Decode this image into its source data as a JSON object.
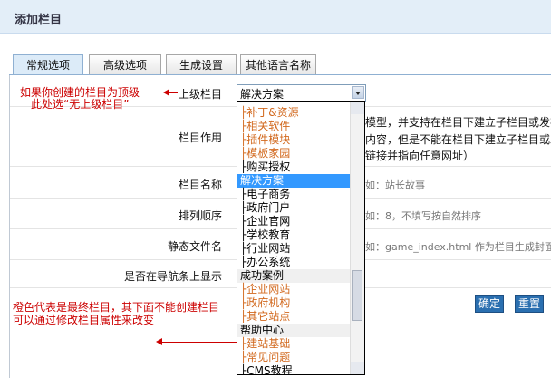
{
  "header": {
    "title": "添加栏目"
  },
  "tabs": [
    {
      "label": "常规选项",
      "active": true
    },
    {
      "label": "高级选项",
      "active": false
    },
    {
      "label": "生成设置",
      "active": false
    },
    {
      "label": "其他语言名称",
      "active": false
    }
  ],
  "form": {
    "parent": {
      "label": "上级栏目",
      "value": "解决方案"
    },
    "role": {
      "label": "栏目作用",
      "text1": "模型，并支持在栏目下建立子栏目或发布",
      "text2": "内容，但是不能在栏目下建立子栏目或发布",
      "text3": "链接并指向任意网址）"
    },
    "name": {
      "label": "栏目名称",
      "hint": "如：站长故事"
    },
    "order": {
      "label": "排列顺序",
      "hint": "如：8，不填写按自然排序"
    },
    "static": {
      "label": "静态文件名",
      "hint": "如：game_index.html 作为栏目生成封面"
    },
    "nav": {
      "label": "是否在导航条上显示"
    }
  },
  "notes": {
    "top_line1": "如果你创建的栏目为顶级",
    "top_line2": "此处选“无上级栏目”",
    "bottom_line1": "橙色代表是最终栏目，其下面不能创建栏目",
    "bottom_line2": "可以通过修改栏目属性来改变"
  },
  "dropdown": {
    "options": [
      {
        "label": "├补丁&资源",
        "kind": "leaf"
      },
      {
        "label": "├相关软件",
        "kind": "leaf"
      },
      {
        "label": "├插件模块",
        "kind": "leaf"
      },
      {
        "label": "├模板家园",
        "kind": "leaf"
      },
      {
        "label": "├购买授权",
        "kind": "normal"
      },
      {
        "label": "解决方案",
        "kind": "selected"
      },
      {
        "label": "├电子商务",
        "kind": "normal"
      },
      {
        "label": "├政府门户",
        "kind": "normal"
      },
      {
        "label": "├企业官网",
        "kind": "normal"
      },
      {
        "label": "├学校教育",
        "kind": "normal"
      },
      {
        "label": "├行业网站",
        "kind": "normal"
      },
      {
        "label": "├办公系统",
        "kind": "normal"
      },
      {
        "label": "成功案例",
        "kind": "group"
      },
      {
        "label": "├企业网站",
        "kind": "leaf"
      },
      {
        "label": "├政府机构",
        "kind": "leaf"
      },
      {
        "label": "├其它站点",
        "kind": "leaf"
      },
      {
        "label": "帮助中心",
        "kind": "group"
      },
      {
        "label": "├建站基础",
        "kind": "leaf"
      },
      {
        "label": "├常见问题",
        "kind": "leaf"
      },
      {
        "label": "├CMS教程",
        "kind": "normal"
      }
    ]
  },
  "buttons": {
    "confirm": "确定",
    "reset": "重置"
  },
  "colors": {
    "accent": "#2a6fb0",
    "selected": "#3399ff",
    "leaf": "#d2691e",
    "note": "#cc0000"
  }
}
